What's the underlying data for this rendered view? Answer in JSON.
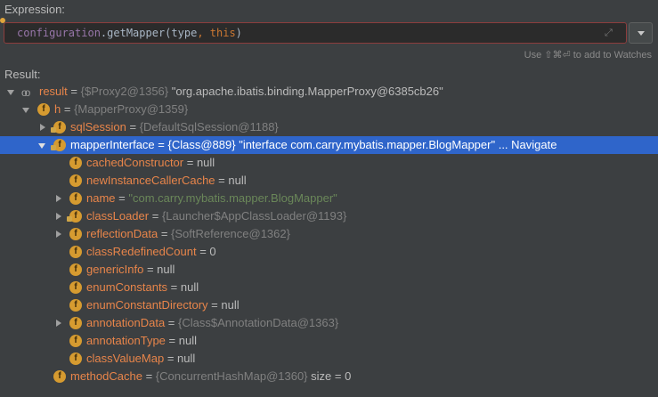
{
  "expression": {
    "label": "Expression:",
    "tokens": {
      "ident": "configuration",
      "dot": ".",
      "method": "getMapper(",
      "arg1": "type",
      "comma": ", ",
      "kw": "this",
      "close": ")"
    },
    "watch_hint": "Use ⇧⌘⏎ to add to Watches"
  },
  "result": {
    "label": "Result:",
    "rows": [
      {
        "name": "result",
        "eq": " = ",
        "ref": "{$Proxy2@1356} ",
        "value": "\"org.apache.ibatis.binding.MapperProxy@6385cb26\""
      },
      {
        "name": "h",
        "eq": " = ",
        "ref": "{MapperProxy@1359}",
        "value": ""
      },
      {
        "name": "sqlSession",
        "eq": " = ",
        "ref": "{DefaultSqlSession@1188}",
        "value": ""
      },
      {
        "name": "mapperInterface",
        "eq": " = ",
        "ref": "{Class@889} ",
        "value": "\"interface com.carry.mybatis.mapper.BlogMapper\"",
        "extra": " ... Navigate"
      },
      {
        "name": "cachedConstructor",
        "eq": " = ",
        "ref": "",
        "value": "null"
      },
      {
        "name": "newInstanceCallerCache",
        "eq": " = ",
        "ref": "",
        "value": "null"
      },
      {
        "name": "name",
        "eq": " = ",
        "ref": "",
        "value": "\"com.carry.mybatis.mapper.BlogMapper\""
      },
      {
        "name": "classLoader",
        "eq": " = ",
        "ref": "{Launcher$AppClassLoader@1193}",
        "value": ""
      },
      {
        "name": "reflectionData",
        "eq": " = ",
        "ref": "{SoftReference@1362}",
        "value": ""
      },
      {
        "name": "classRedefinedCount",
        "eq": " = ",
        "ref": "",
        "value": "0"
      },
      {
        "name": "genericInfo",
        "eq": " = ",
        "ref": "",
        "value": "null"
      },
      {
        "name": "enumConstants",
        "eq": " = ",
        "ref": "",
        "value": "null"
      },
      {
        "name": "enumConstantDirectory",
        "eq": " = ",
        "ref": "",
        "value": "null"
      },
      {
        "name": "annotationData",
        "eq": " = ",
        "ref": "{Class$AnnotationData@1363}",
        "value": ""
      },
      {
        "name": "annotationType",
        "eq": " = ",
        "ref": "",
        "value": "null"
      },
      {
        "name": "classValueMap",
        "eq": " = ",
        "ref": "",
        "value": "null"
      },
      {
        "name": "methodCache",
        "eq": " = ",
        "ref": "{ConcurrentHashMap@1360}",
        "value": "  size = 0"
      }
    ]
  },
  "icons": {
    "field": "f",
    "watch": "oo"
  }
}
